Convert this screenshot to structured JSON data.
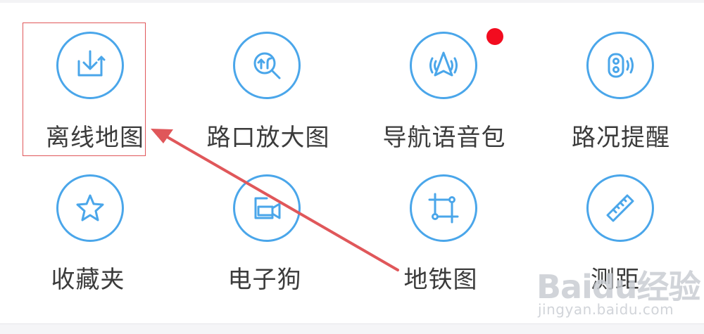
{
  "tools": {
    "row1": [
      {
        "label": "离线地图",
        "icon": "offline-map-download-icon"
      },
      {
        "label": "路口放大图",
        "icon": "junction-zoom-icon"
      },
      {
        "label": "导航语音包",
        "icon": "navigation-voice-icon",
        "badge": "red-dot"
      },
      {
        "label": "路况提醒",
        "icon": "traffic-alert-icon"
      }
    ],
    "row2": [
      {
        "label": "收藏夹",
        "icon": "star-icon"
      },
      {
        "label": "电子狗",
        "icon": "camera-icon"
      },
      {
        "label": "地铁图",
        "icon": "subway-map-icon"
      },
      {
        "label": "测距",
        "icon": "ruler-icon"
      }
    ]
  },
  "watermark": {
    "main": "Baidu经验",
    "sub": "jingyan.baidu.com"
  },
  "colors": {
    "accent": "#4aa6ea",
    "badge": "#f20c1f",
    "annotation": "#e0575a",
    "label": "#3b3b3b"
  }
}
